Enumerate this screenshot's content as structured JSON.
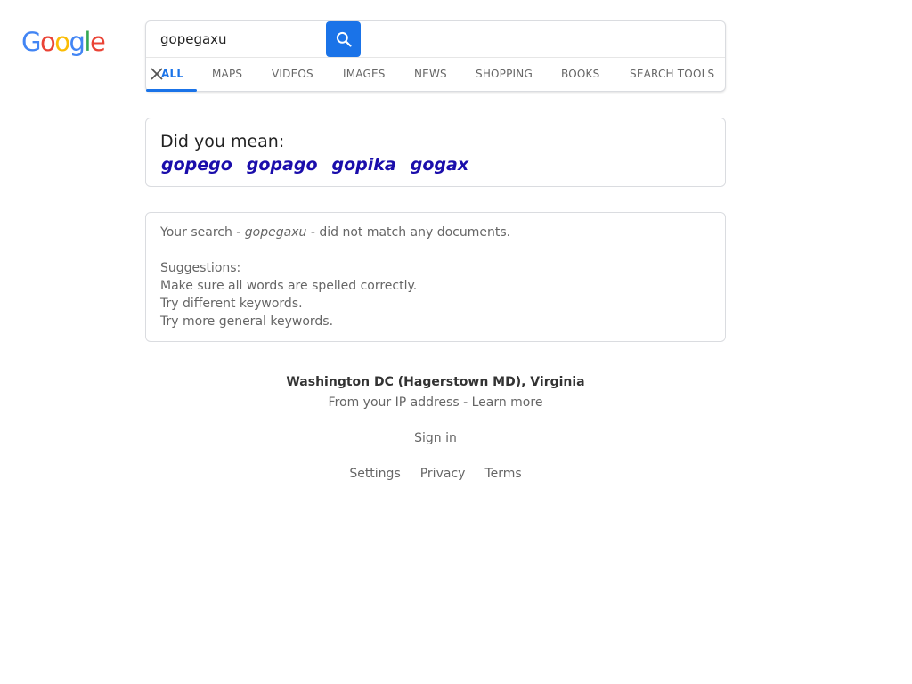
{
  "logo": {
    "letters": [
      "G",
      "o",
      "o",
      "g",
      "l",
      "e"
    ],
    "colors": [
      "#4285F4",
      "#EA4335",
      "#FBBC05",
      "#4285F4",
      "#34A853",
      "#EA4335"
    ]
  },
  "search": {
    "query": "gopegaxu",
    "button_icon": "search-icon"
  },
  "tabs": [
    {
      "label": "ALL",
      "active": true
    },
    {
      "label": "MAPS"
    },
    {
      "label": "VIDEOS"
    },
    {
      "label": "IMAGES"
    },
    {
      "label": "NEWS"
    },
    {
      "label": "SHOPPING"
    },
    {
      "label": "BOOKS"
    },
    {
      "label": "SEARCH TOOLS"
    }
  ],
  "did_you_mean": {
    "title": "Did you mean:",
    "suggestions": [
      "gopego",
      "gopago",
      "gopika",
      "gogax"
    ]
  },
  "no_match": {
    "prefix": "Your search - ",
    "query": "gopegaxu",
    "suffix": " - did not match any documents.",
    "suggestions_title": "Suggestions:",
    "tips": [
      "Make sure all words are spelled correctly.",
      "Try different keywords.",
      "Try more general keywords."
    ]
  },
  "location": {
    "name": "Washington DC (Hagerstown MD), Virginia",
    "source": "From your IP address",
    "separator": " - ",
    "learn_more": "Learn more"
  },
  "footer": {
    "sign_in": "Sign in",
    "links": [
      "Settings",
      "Privacy",
      "Terms"
    ]
  },
  "colors": {
    "accent": "#1a73e8",
    "link": "#1a0dab"
  }
}
